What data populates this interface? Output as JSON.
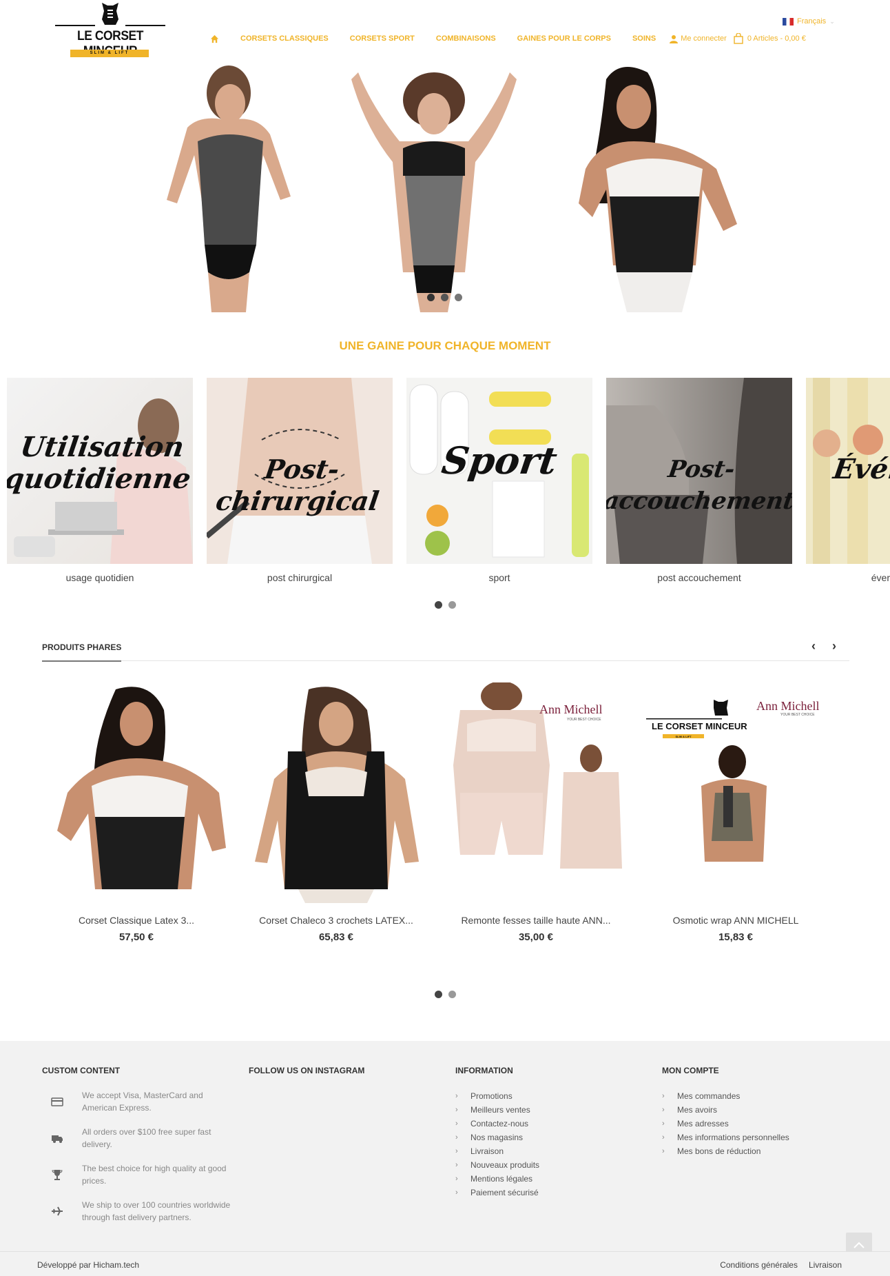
{
  "header": {
    "logo": {
      "name": "LE CORSET MINCEUR",
      "tagline": "SLIM & LIFT"
    },
    "language": "Français",
    "nav": [
      {
        "label": "CORSETS CLASSIQUES"
      },
      {
        "label": "CORSETS SPORT"
      },
      {
        "label": "COMBINAISONS"
      },
      {
        "label": "GAINES POUR LE CORPS"
      },
      {
        "label": "SOINS"
      }
    ],
    "login": "Me connecter",
    "cart": "0 Articles - 0,00 €"
  },
  "hero": {
    "slides": 3,
    "active_slide": 1
  },
  "moments": {
    "title": "UNE GAINE POUR CHAQUE MOMENT",
    "items": [
      {
        "script": "Utilisation quotidienne",
        "caption": "usage quotidien"
      },
      {
        "script": "Post-chirurgical",
        "caption": "post chirurgical"
      },
      {
        "script": "Sport",
        "caption": "sport"
      },
      {
        "script": "Post-accouchement",
        "caption": "post accouchement"
      },
      {
        "script": "Évén",
        "caption": "éver"
      }
    ]
  },
  "products": {
    "title": "PRODUITS PHARES",
    "prev_icon": "chevron-left-icon",
    "next_icon": "chevron-right-icon",
    "items": [
      {
        "name": "Corset Classique Latex 3...",
        "price": "57,50 €"
      },
      {
        "name": "Corset Chaleco 3 crochets LATEX...",
        "price": "65,83 €"
      },
      {
        "name": "Remonte fesses taille haute ANN...",
        "price": "35,00 €",
        "brand": "Ann Michell",
        "brand_sub": "YOUR BEST CHOICE"
      },
      {
        "name": "Osmotic wrap ANN MICHELL",
        "price": "15,83 €",
        "brand": "Ann Michell",
        "brand_sub": "YOUR BEST CHOICE",
        "logo_name": "LE CORSET MINCEUR",
        "logo_tag": "SLIM & LIFT"
      }
    ]
  },
  "footer": {
    "custom": {
      "title": "CUSTOM CONTENT",
      "items": [
        {
          "icon": "credit-card-icon",
          "text": "We accept Visa, MasterCard and American Express."
        },
        {
          "icon": "truck-icon",
          "text": "All orders over $100 free super fast delivery."
        },
        {
          "icon": "trophy-icon",
          "text": "The best choice for high quality at good prices."
        },
        {
          "icon": "plane-icon",
          "text": "We ship to over 100 countries worldwide through fast delivery partners."
        }
      ]
    },
    "instagram": {
      "title": "FOLLOW US ON INSTAGRAM"
    },
    "information": {
      "title": "INFORMATION",
      "links": [
        "Promotions",
        "Meilleurs ventes",
        "Contactez-nous",
        "Nos magasins",
        "Livraison",
        "Nouveaux produits",
        "Mentions légales",
        "Paiement sécurisé"
      ]
    },
    "account": {
      "title": "MON COMPTE",
      "links": [
        "Mes commandes",
        "Mes avoirs",
        "Mes adresses",
        "Mes informations personnelles",
        "Mes bons de réduction"
      ]
    }
  },
  "bottom": {
    "developer": "Développé par Hicham.tech",
    "links": [
      "Conditions générales",
      "Livraison"
    ]
  },
  "colors": {
    "accent": "#f0b429",
    "footer_bg": "#f2f2f2"
  }
}
